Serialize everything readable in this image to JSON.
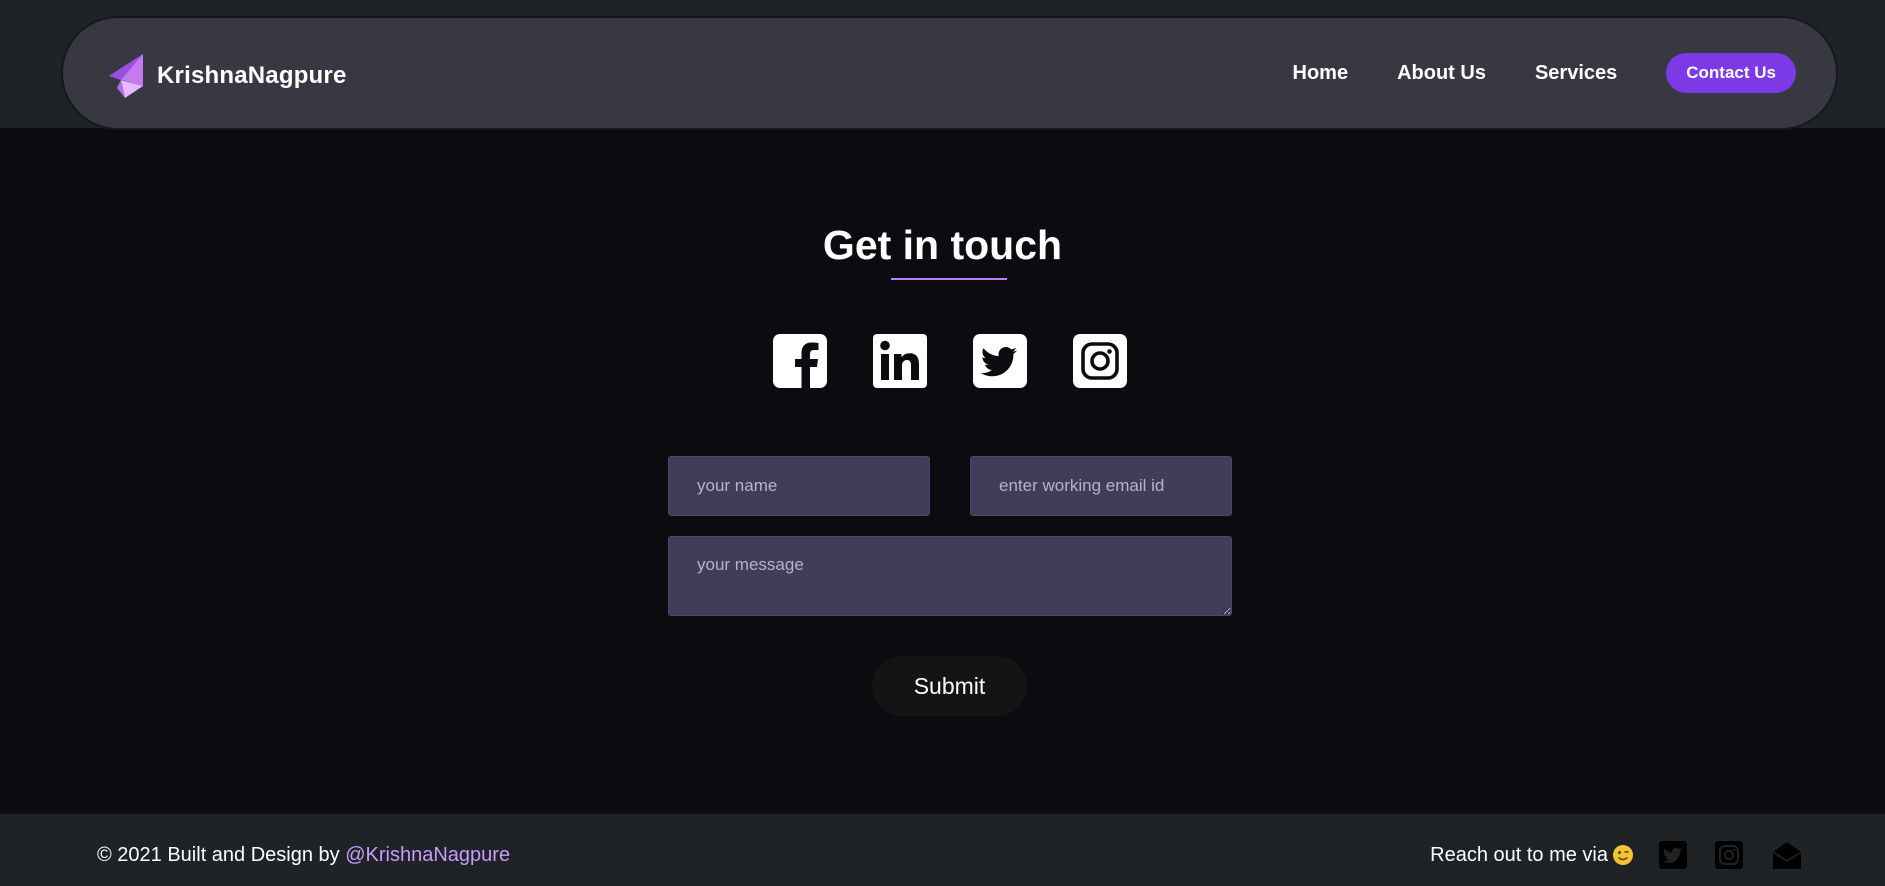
{
  "brand": {
    "name": "KrishnaNagpure",
    "logo_icon": "paper-plane-logo-icon"
  },
  "nav": {
    "links": [
      {
        "label": "Home"
      },
      {
        "label": "About Us"
      },
      {
        "label": "Services"
      }
    ],
    "cta_label": "Contact Us"
  },
  "main": {
    "title": "Get in touch",
    "social_icons": [
      "facebook-icon",
      "linkedin-icon",
      "twitter-icon",
      "instagram-icon"
    ],
    "form": {
      "name_placeholder": "your name",
      "email_placeholder": "enter working email id",
      "message_placeholder": "your message",
      "submit_label": "Submit"
    }
  },
  "footer": {
    "copyright_prefix": "© 2021 Built and Design by ",
    "handle": "@KrishnaNagpure",
    "reach_label": "Reach out to me via",
    "reach_icons": [
      "wink-emoji-icon",
      "twitter-icon",
      "instagram-icon",
      "mail-icon"
    ]
  },
  "colors": {
    "page_bg": "#0b0c10",
    "header_bg": "#1f2326",
    "navbar_bg": "#383843",
    "accent": "#7b3ae6",
    "underline": "#c07cff",
    "handle": "#c79bff",
    "input_bg": "#3f3d59"
  }
}
